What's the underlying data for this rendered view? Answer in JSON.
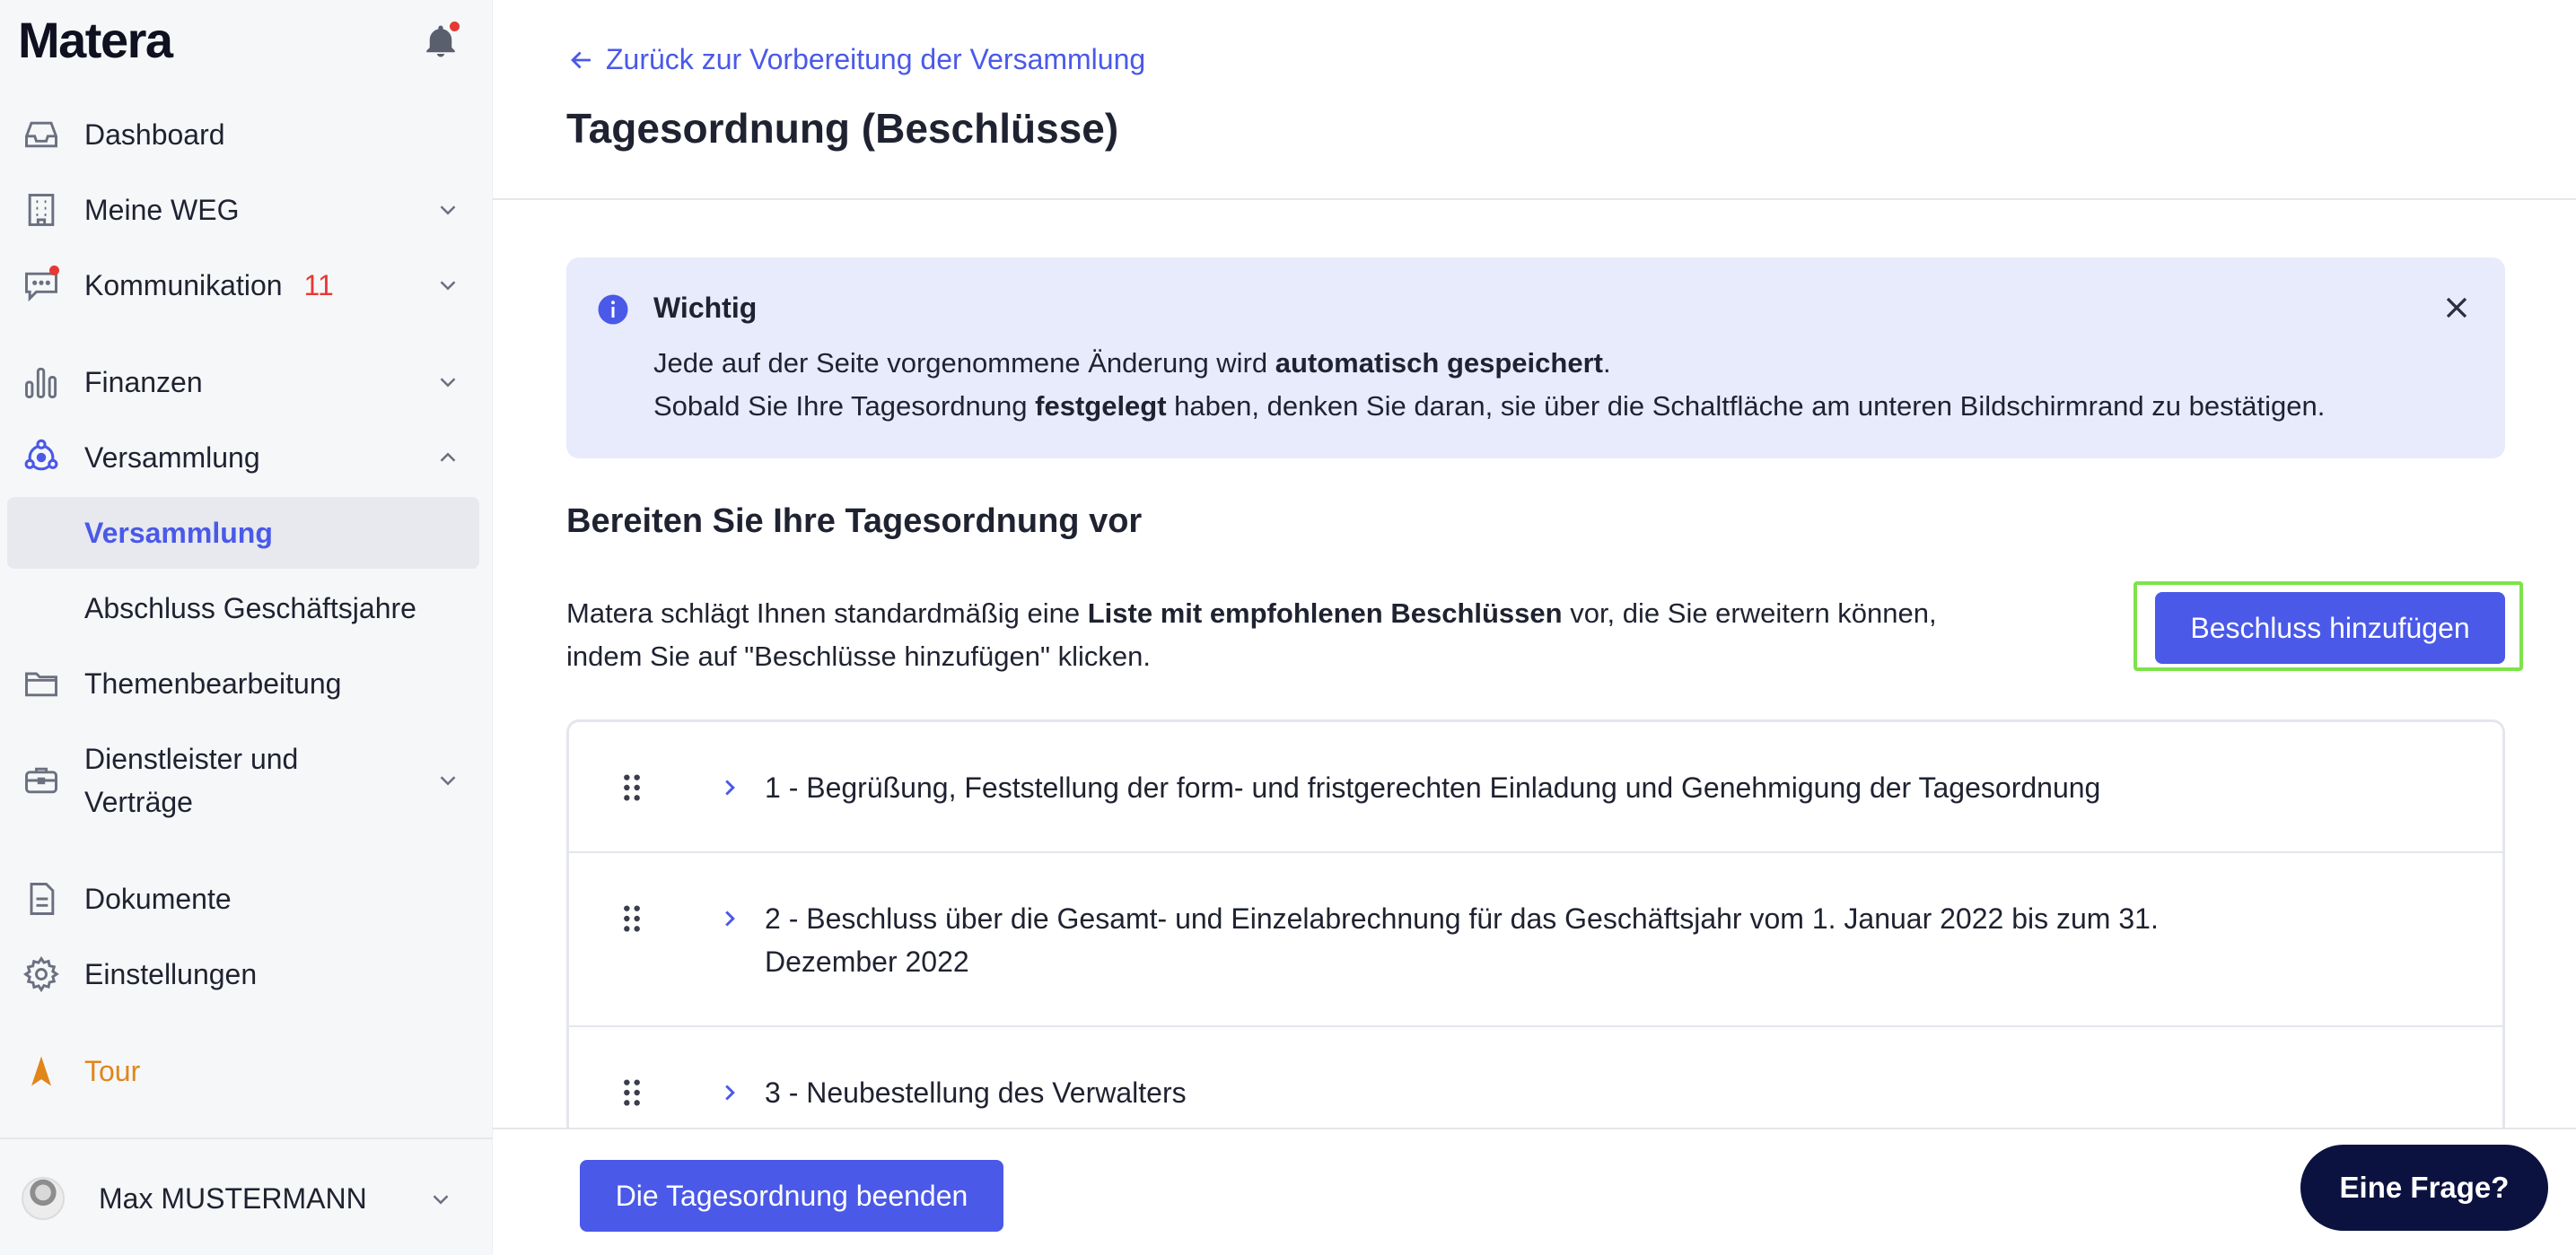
{
  "sidebar": {
    "brand": "Matera",
    "items": {
      "dashboard": {
        "label": "Dashboard",
        "icon": "inbox-icon"
      },
      "meine_weg": {
        "label": "Meine WEG",
        "icon": "building-icon"
      },
      "kommunikation": {
        "label": "Kommunikation",
        "badge": "11",
        "icon": "chat-icon"
      },
      "finanzen": {
        "label": "Finanzen",
        "icon": "bar-chart-icon"
      },
      "versammlung": {
        "label": "Versammlung",
        "icon": "people-network-icon"
      },
      "versammlung_sub": {
        "label": "Versammlung"
      },
      "abschluss": {
        "label": "Abschluss Geschäftsjahre"
      },
      "themen": {
        "label": "Themenbearbeitung",
        "icon": "folder-icon"
      },
      "dienstleister_line1": "Dienstleister und",
      "dienstleister_line2": "Verträge",
      "dokumente": {
        "label": "Dokumente",
        "icon": "document-icon"
      },
      "einstellungen": {
        "label": "Einstellungen",
        "icon": "gear-icon"
      },
      "tour": {
        "label": "Tour",
        "icon": "navigation-arrow-icon"
      }
    },
    "user": {
      "name": "Max MUSTERMANN"
    }
  },
  "main": {
    "back_link": "Zurück zur Vorbereitung der Versammlung",
    "title": "Tagesordnung (Beschlüsse)",
    "info": {
      "title": "Wichtig",
      "line1_pre": "Jede auf der Seite vorgenommene Änderung wird ",
      "line1_bold": "automatisch gespeichert",
      "line1_post": ".",
      "line2_pre": "Sobald Sie Ihre Tagesordnung ",
      "line2_bold": "festgelegt",
      "line2_post": " haben, denken Sie daran, sie über die Schaltfläche am unteren Bildschirmrand zu bestätigen."
    },
    "section_title": "Bereiten Sie Ihre Tagesordnung vor",
    "desc": {
      "pre": "Matera schlägt Ihnen standardmäßig eine ",
      "bold": "Liste mit empfohlenen Beschlüssen",
      "post": " vor, die Sie erweitern können,",
      "line2": "indem Sie auf \"Beschlüsse hinzufügen\" klicken."
    },
    "add_button": "Beschluss hinzufügen",
    "agenda": [
      {
        "text": "1 - Begrüßung, Feststellung der form- und fristgerechten Einladung und Genehmigung der Tagesordnung"
      },
      {
        "text": "2 - Beschluss über die Gesamt- und Einzelabrechnung für das Geschäftsjahr vom 1. Januar 2022 bis zum 31. Dezember 2022"
      },
      {
        "text": "3 - Neubestellung des Verwalters"
      }
    ],
    "finish_button": "Die Tagesordnung beenden",
    "question_button": "Eine Frage?"
  },
  "colors": {
    "accent": "#4a59e8",
    "badge_red": "#e53935",
    "tour_orange": "#e0861b",
    "info_bg": "#e7ebfb",
    "highlight_border": "#7de34a",
    "question_bg": "#0c1240"
  }
}
